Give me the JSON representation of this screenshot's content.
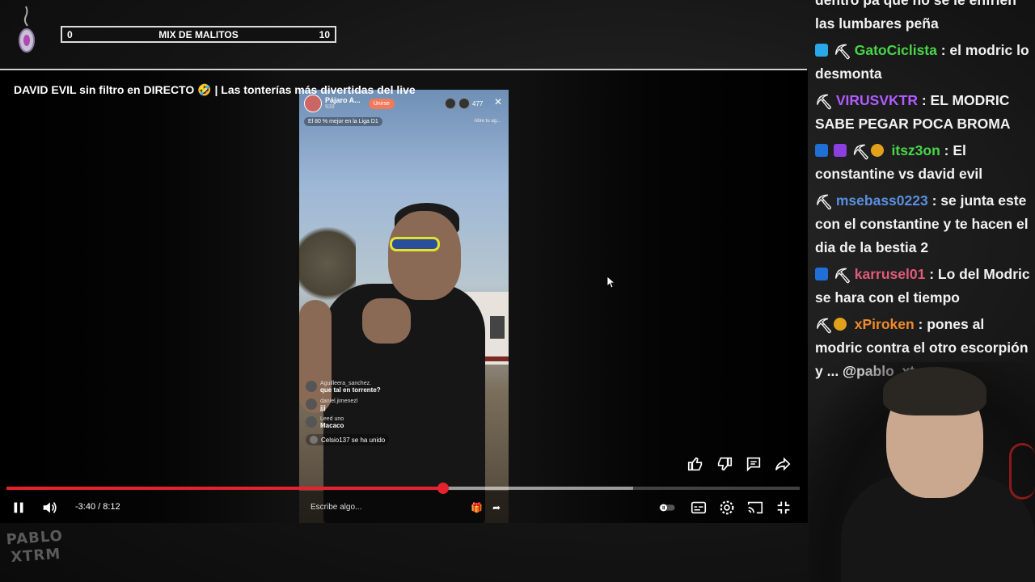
{
  "overlay": {
    "scorebar": {
      "left_score": "0",
      "title": "MIX DE MALITOS",
      "right_score": "10"
    }
  },
  "video": {
    "title": "DAVID EVIL sin filtro en DIRECTO 🤣 | Las tonterías más divertidas del live",
    "time": "-3:40 / 8:12",
    "progress": {
      "played_fraction": 0.55,
      "buffered_fraction": 0.79
    }
  },
  "tiktok": {
    "name": "Pájaro A...",
    "likes": "939",
    "join_label": "Unirse",
    "viewers": "477",
    "close_label": "✕",
    "rank_text": "El 80 % mejor en la Liga D1",
    "explore_text": "Abre tu ag...",
    "comments": [
      {
        "user": "Aguilleera_sanchez.",
        "msg": "que tal en torrente?"
      },
      {
        "user": "daniel.jimenezl",
        "msg": "jjj"
      },
      {
        "user": "Leed uno",
        "msg": "Macaco"
      }
    ],
    "joined_text": "Celsio137 se ha unido",
    "input_placeholder": "Escribe algo..."
  },
  "branding": {
    "bottom_logo": "PABLO XTRM"
  },
  "chat": {
    "messages": [
      {
        "user": "",
        "user_color": "#ffffff",
        "text": "dentro pa que no se le enfríen las lumbares peña",
        "badges": []
      },
      {
        "user": "GatoCiclista",
        "user_color": "#48d648",
        "text": " : el modric lo desmonta",
        "badges": [
          "cube-icon",
          "pick-icon"
        ]
      },
      {
        "user": "VIRUSVKTR",
        "user_color": "#b05cff",
        "text": " : EL MODRIC SABE PEGAR POCA BROMA",
        "badges": [
          "pick-icon"
        ]
      },
      {
        "user": "itsz3on",
        "user_color": "#48d648",
        "text": " : El constantine vs david evil",
        "badges": [
          "lightning-icon",
          "purple-cube-icon",
          "pick-icon",
          "gold-coin-icon"
        ]
      },
      {
        "user": "msebass0223",
        "user_color": "#5a8fe0",
        "text": " : se junta este con el constantine y te hacen el dia de la bestia 2",
        "badges": [
          "pick-icon"
        ]
      },
      {
        "user": "karrusel01",
        "user_color": "#e05a7a",
        "text": " : Lo del Modric se hara con el tiempo",
        "badges": [
          "lightning-icon",
          "pick-icon"
        ]
      },
      {
        "user": "xPiroken",
        "user_color": "#f08a2a",
        "text": " : pones al modric contra el otro escorpión y ... @pablo_xt...",
        "badges": [
          "pick-icon",
          "gold-coin-icon"
        ]
      }
    ]
  }
}
